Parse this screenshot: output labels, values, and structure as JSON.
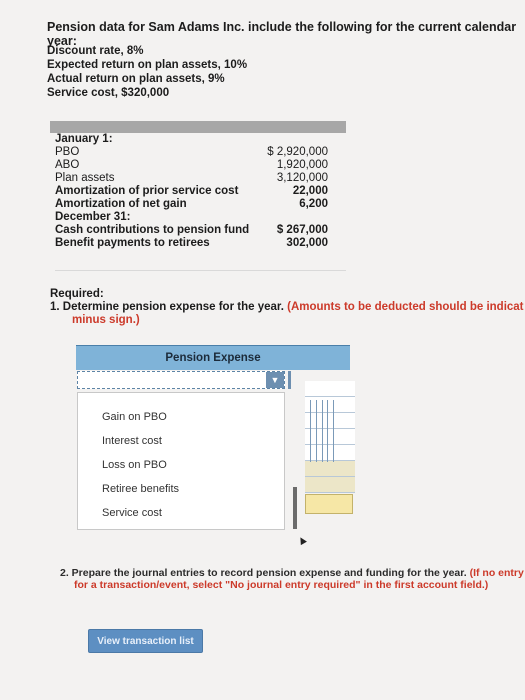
{
  "title": "Pension data for Sam Adams Inc. include the following for the current calendar year:",
  "givens": [
    "Discount rate, 8%",
    "Expected return on plan assets, 10%",
    "Actual return on plan assets, 9%",
    "Service cost, $320,000"
  ],
  "table": {
    "jan_header": "January 1:",
    "jan_rows": [
      {
        "label": "PBO",
        "value": "$ 2,920,000"
      },
      {
        "label": "ABO",
        "value": "1,920,000"
      },
      {
        "label": "Plan assets",
        "value": "3,120,000"
      },
      {
        "label": "Amortization of prior service cost",
        "value": "22,000"
      },
      {
        "label": "Amortization of net gain",
        "value": "6,200"
      }
    ],
    "dec_header": "December 31:",
    "dec_rows": [
      {
        "label": "Cash contributions to pension fund",
        "value": "$ 267,000"
      },
      {
        "label": "Benefit payments to retirees",
        "value": "302,000"
      }
    ]
  },
  "required": {
    "heading": "Required:",
    "q1_text": "1. Determine pension expense for the year.",
    "q1_note_line1": "(Amounts to be deducted should be indicat",
    "q1_note_line2": "minus sign.)"
  },
  "pension_expense": {
    "header": "Pension Expense",
    "dropdown_arrow": "▼",
    "options": [
      "Gain on PBO",
      "Interest cost",
      "Loss on PBO",
      "Retiree benefits",
      "Service cost"
    ]
  },
  "q2": {
    "text": "2. Prepare the journal entries to record pension expense and funding for the year.",
    "note_line1": "(If no entry",
    "note_line2": "for a transaction/event, select \"No journal entry required\" in the first account field.)"
  },
  "view_button": "View transaction list",
  "colors": {
    "header_blue": "#7fb3d8",
    "button_blue": "#5d8fc2",
    "note_red": "#cc3a2a",
    "highlight_yellow": "#f6e7a6"
  }
}
